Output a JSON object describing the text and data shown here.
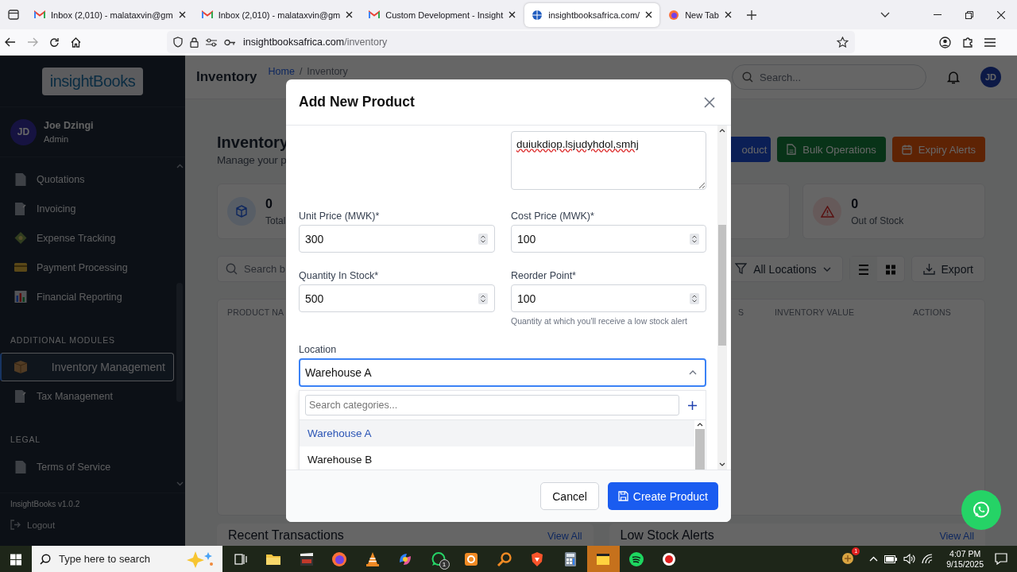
{
  "browser": {
    "tabs": [
      {
        "title": "Inbox (2,010) - malataxvin@gm",
        "selected": false
      },
      {
        "title": "Inbox (2,010) - malataxvin@gm",
        "selected": false
      },
      {
        "title": "Custom Development - Insight",
        "selected": false
      },
      {
        "title": "insightbooksafrica.com/",
        "selected": true
      },
      {
        "title": "New Tab",
        "selected": false
      }
    ],
    "url_host": "insightbooksafrica.com",
    "url_path": "/inventory"
  },
  "sidebar": {
    "logo": "insightBooks",
    "user": {
      "initials": "JD",
      "name": "Joe Dzingi",
      "role": "Admin"
    },
    "groups": [
      {
        "items": [
          {
            "label": "Quotations",
            "selected": false
          },
          {
            "label": "Invoicing",
            "selected": false
          },
          {
            "label": "Expense Tracking",
            "selected": false
          },
          {
            "label": "Payment Processing",
            "selected": false
          },
          {
            "label": "Financial Reporting",
            "selected": false
          }
        ]
      },
      {
        "heading": "ADDITIONAL MODULES",
        "items": [
          {
            "label": "Inventory Management",
            "selected": true
          },
          {
            "label": "Tax Management",
            "selected": false
          }
        ]
      },
      {
        "heading": "LEGAL",
        "items": [
          {
            "label": "Terms of Service",
            "selected": false
          }
        ]
      }
    ],
    "version": "InsightBooks v1.0.2",
    "logout": "Logout"
  },
  "header": {
    "title": "Inventory",
    "breadcrumb": [
      {
        "label": "Home",
        "link": true
      },
      {
        "label": "Inventory",
        "link": false
      }
    ],
    "separator": "/",
    "search_placeholder": "Search...",
    "avatar": "JD"
  },
  "page": {
    "title": "Inventory",
    "subtitle": "Manage your p",
    "actions": [
      {
        "label": "oduct",
        "kind": "primary"
      },
      {
        "label": "Bulk Operations",
        "kind": "success"
      },
      {
        "label": "Expiry Alerts",
        "kind": "danger"
      }
    ],
    "stats": [
      {
        "value": "0",
        "label": "Total",
        "kind": "box"
      },
      {
        "value": "0",
        "label": "Out of Stock",
        "kind": "alert"
      }
    ],
    "filters": {
      "search_placeholder": "Search b",
      "location": "All Locations",
      "export": "Export"
    },
    "table": {
      "columns": [
        "PRODUCT NA",
        "S",
        "INVENTORY VALUE",
        "ACTIONS"
      ]
    },
    "panels": [
      {
        "title": "Recent Transactions",
        "link": "View All"
      },
      {
        "title": "Low Stock Alerts",
        "link": "View All"
      }
    ]
  },
  "modal": {
    "title": "Add New Product",
    "description": "duiukdiop.lsjudyhdol,smhj",
    "fields": [
      {
        "label": "Unit Price (MWK)*",
        "value": "300"
      },
      {
        "label": "Cost Price (MWK)*",
        "value": "100"
      },
      {
        "label": "Quantity In Stock*",
        "value": "500"
      },
      {
        "label": "Reorder Point*",
        "value": "100",
        "hint": "Quantity at which you'll receive a low stock alert"
      }
    ],
    "location": {
      "label": "Location",
      "value": "Warehouse A",
      "open": true,
      "search_placeholder": "Search categories...",
      "options": [
        {
          "label": "Warehouse A",
          "selected": true
        },
        {
          "label": "Warehouse B",
          "selected": false
        }
      ]
    },
    "cancel": "Cancel",
    "submit": "Create Product"
  },
  "taskbar": {
    "search_placeholder": "Type here to search",
    "apps": [
      {
        "kind": "taskview",
        "active": false
      },
      {
        "kind": "folder",
        "active": false
      },
      {
        "kind": "clapper",
        "active": false
      },
      {
        "kind": "firefox",
        "active": false
      },
      {
        "kind": "cone",
        "active": false
      },
      {
        "kind": "copilot",
        "active": false
      },
      {
        "kind": "whatsapp",
        "active": false,
        "badge": "1"
      },
      {
        "kind": "orange",
        "active": false
      },
      {
        "kind": "magnifier",
        "active": false
      },
      {
        "kind": "brave",
        "active": false
      },
      {
        "kind": "calculator",
        "active": false
      },
      {
        "kind": "notes",
        "active": true
      },
      {
        "kind": "spotify",
        "active": false
      },
      {
        "kind": "record",
        "active": false
      }
    ],
    "tray_badge": "1",
    "time": "4:07 PM",
    "date": "9/15/2025"
  }
}
